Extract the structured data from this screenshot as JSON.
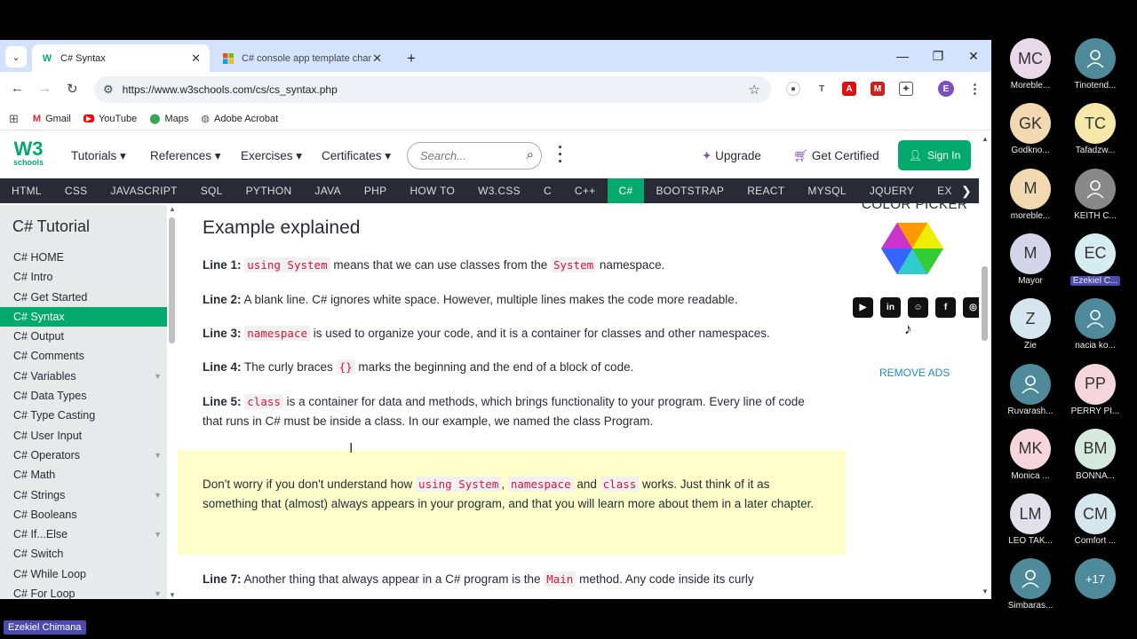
{
  "browser": {
    "tabs": [
      {
        "title": "C# Syntax",
        "active": true,
        "favicon": "w3-favicon"
      },
      {
        "title": "C# console app template chang",
        "active": false,
        "favicon": "microsoft-favicon"
      }
    ],
    "new_tab": "+",
    "url": "https://www.w3schools.com/cs/cs_syntax.php",
    "profile_initial": "E",
    "bookmarks": [
      "Gmail",
      "YouTube",
      "Maps",
      "Adobe Acrobat"
    ]
  },
  "w3": {
    "logo_top": "W3",
    "logo_bottom": "schools",
    "menu": [
      "Tutorials",
      "References",
      "Exercises",
      "Certificates"
    ],
    "search_placeholder": "Search...",
    "upgrade": "Upgrade",
    "get_certified": "Get Certified",
    "sign_in": "Sign In",
    "topnav": [
      "HTML",
      "CSS",
      "JAVASCRIPT",
      "SQL",
      "PYTHON",
      "JAVA",
      "PHP",
      "HOW TO",
      "W3.CSS",
      "C",
      "C++",
      "C#",
      "BOOTSTRAP",
      "REACT",
      "MYSQL",
      "JQUERY",
      "EX"
    ],
    "topnav_active": "C#"
  },
  "sidebar": {
    "title": "C# Tutorial",
    "items": [
      "C# HOME",
      "C# Intro",
      "C# Get Started",
      "C# Syntax",
      "C# Output",
      "C# Comments",
      "C# Variables",
      "C# Data Types",
      "C# Type Casting",
      "C# User Input",
      "C# Operators",
      "C# Math",
      "C# Strings",
      "C# Booleans",
      "C# If...Else",
      "C# Switch",
      "C# While Loop",
      "C# For Loop"
    ],
    "active": "C# Syntax"
  },
  "main": {
    "heading": "Example explained",
    "l1_label": "Line 1:",
    "l1_code": "using System",
    "l1_a": " means that we can use classes from the ",
    "l1_code2": "System",
    "l1_b": " namespace.",
    "l2_label": "Line 2:",
    "l2_text": " A blank line. C# ignores white space. However, multiple lines makes the code more readable.",
    "l3_label": "Line 3:",
    "l3_code": "namespace",
    "l3_text": " is used to organize your code, and it is a container for classes and other namespaces.",
    "l4_label": "Line 4:",
    "l4_a": " The curly braces ",
    "l4_code": "{}",
    "l4_b": " marks the beginning and the end of a block of code.",
    "l5_label": "Line 5:",
    "l5_code": "class",
    "l5_text": " is a container for data and methods, which brings functionality to your program. Every line of code that runs in C# must be inside a class. In our example, we named the class Program.",
    "note_a": "Don't worry if you don't understand how ",
    "note_code1": "using System",
    "note_b": ", ",
    "note_code2": "namespace",
    "note_c": " and ",
    "note_code3": "class",
    "note_d": " works. Just think of it as something that (almost) always appears in your program, and that you will learn more about them in a later chapter.",
    "l7_label": "Line 7:",
    "l7_a": " Another thing that always appear in a C# program is the ",
    "l7_code": "Main",
    "l7_b": " method. Any code inside its curly"
  },
  "ads": {
    "color_picker": "COLOR PICKER",
    "remove_ads": "REMOVE ADS"
  },
  "participants": [
    {
      "initials": "MC",
      "name": "Moreble...",
      "color": "#e8d8e8"
    },
    {
      "initials": "",
      "name": "Tinotend...",
      "color": "#4f8a9a"
    },
    {
      "initials": "GK",
      "name": "Godkno...",
      "color": "#f3d9b1"
    },
    {
      "initials": "TC",
      "name": "Tafadzw...",
      "color": "#f6e8a8"
    },
    {
      "initials": "M",
      "name": "moreble...",
      "color": "#f3d9b1"
    },
    {
      "initials": "",
      "name": "KEITH C...",
      "color": "#888888"
    },
    {
      "initials": "M",
      "name": "Mayor",
      "color": "#d5d5ea"
    },
    {
      "initials": "EC",
      "name": "Ezekiel C...",
      "color": "#d6ecf0"
    },
    {
      "initials": "Z",
      "name": "Zie",
      "color": "#d6e6ef"
    },
    {
      "initials": "",
      "name": "nacia ko...",
      "color": "#4f8a9a"
    },
    {
      "initials": "",
      "name": "Ruvarash...",
      "color": "#4f8a9a"
    },
    {
      "initials": "PP",
      "name": "PERRY PI...",
      "color": "#f6d6dc"
    },
    {
      "initials": "MK",
      "name": "Monica ...",
      "color": "#f6d6dc"
    },
    {
      "initials": "BM",
      "name": "BONNA...",
      "color": "#d5e9e0"
    },
    {
      "initials": "LM",
      "name": "LEO TAK...",
      "color": "#e2e0ea"
    },
    {
      "initials": "CM",
      "name": "Comfort ...",
      "color": "#d6e6ef"
    },
    {
      "initials": "",
      "name": "Simbaras...",
      "color": "#4f8a9a"
    },
    {
      "initials": "+17",
      "name": "",
      "color": "#4f8a9a"
    }
  ],
  "presenter": "Ezekiel Chimana"
}
